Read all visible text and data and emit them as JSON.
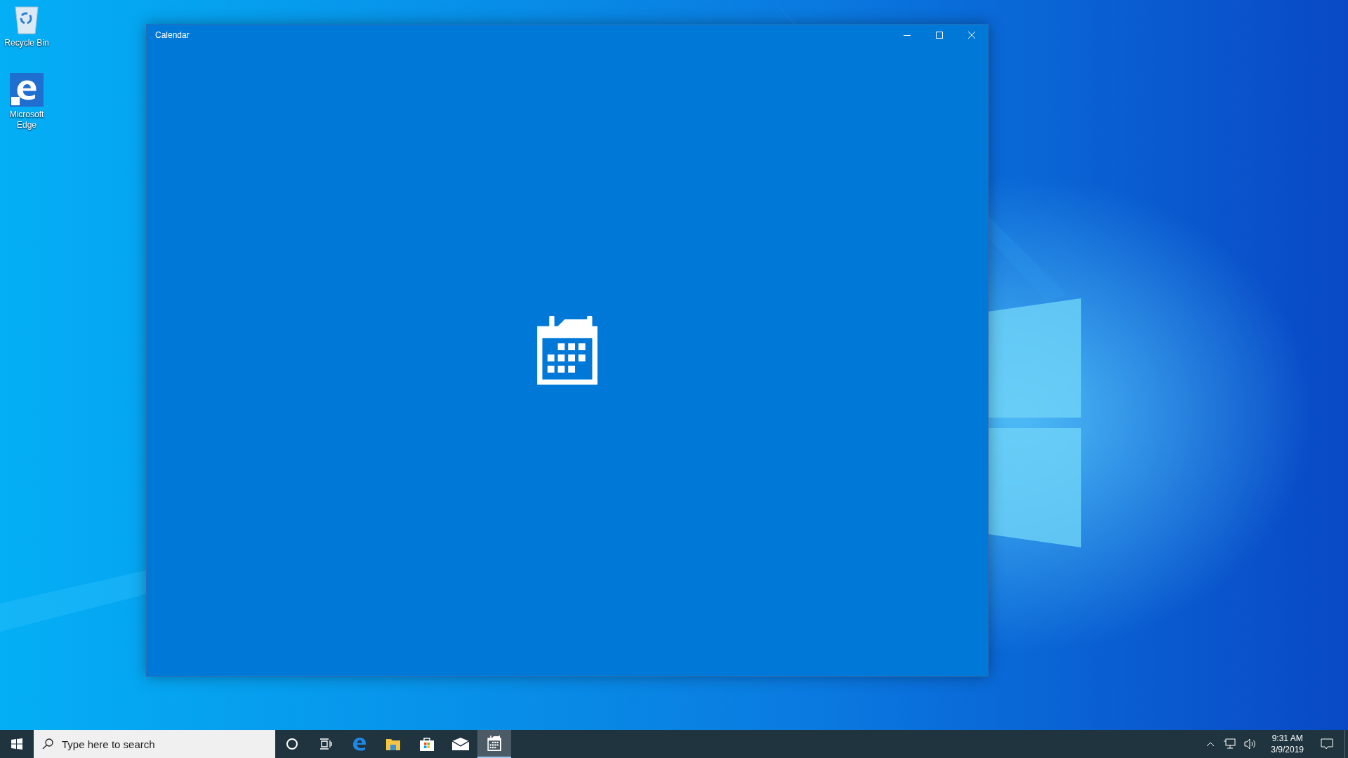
{
  "desktop_icons": [
    {
      "kind": "recycle",
      "label": "Recycle Bin"
    },
    {
      "kind": "edge",
      "label": "Microsoft Edge"
    }
  ],
  "window": {
    "title": "Calendar"
  },
  "taskbar": {
    "search": {
      "placeholder": "Type here to search"
    },
    "apps": [
      {
        "kind": "cortana",
        "selected": false
      },
      {
        "kind": "taskview",
        "selected": false
      },
      {
        "kind": "edge",
        "selected": false
      },
      {
        "kind": "explorer",
        "selected": false
      },
      {
        "kind": "store",
        "selected": false
      },
      {
        "kind": "mail",
        "selected": false
      },
      {
        "kind": "calendar",
        "selected": true
      }
    ],
    "time": "9:31 AM",
    "date": "3/9/2019"
  }
}
